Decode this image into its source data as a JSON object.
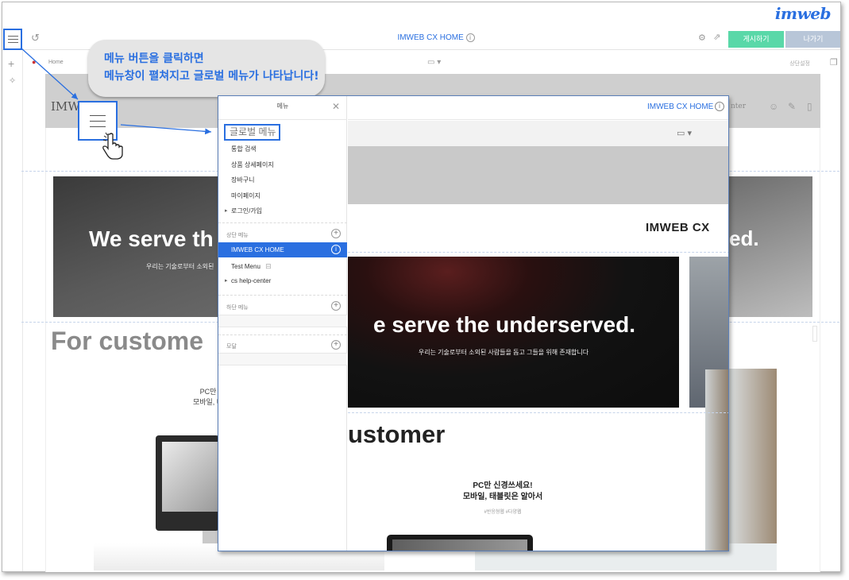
{
  "brand": {
    "logo_text": "imweb",
    "accent_color": "#2a6fe0"
  },
  "toolbar": {
    "menu_icon": "hamburger-icon",
    "undo_icon": "undo-icon",
    "document_title": "IMWEB CX HOME",
    "settings_icon": "gear-icon",
    "preview_icon": "external-link-icon",
    "publish_label": "게시하기",
    "exit_label": "나가기"
  },
  "sub_bar": {
    "home_label": "Home",
    "device_icon": "monitor-icon",
    "right_label": "상단설정"
  },
  "callout": {
    "line1": "메뉴 버튼을 클릭하면",
    "line2": "메뉴창이 펼쳐지고 글로벌 메뉴가 나타납니다!"
  },
  "background_page": {
    "logo": "IMWEB",
    "hero_title": "We serve th",
    "hero_title_right": "ed.",
    "hero_sub": "우리는 기술로부터 소외된",
    "section_title": "For custome",
    "pc_line1": "PC만",
    "pc_line2": "모바일, 태"
  },
  "menu_panel": {
    "title": "메뉴",
    "global_menu_title": "글로벌 메뉴",
    "global_items": [
      "통합 검색",
      "상품 상세페이지",
      "장바구니",
      "마이페이지",
      "로그인/가입"
    ],
    "top_menu_label": "상단 메뉴",
    "top_items": [
      "IMWEB CX HOME",
      "Test Menu",
      "cs help-center"
    ],
    "bottom_menu_label": "하단 메뉴",
    "modal_label": "모달"
  },
  "preview": {
    "page_title": "IMWEB CX HOME",
    "logo": "IMWEB CX",
    "hero_title": "e serve the underserved.",
    "hero_sub": "우리는 기술로부터 소외된 사람들을 돕고 그들을 위해 존재합니다",
    "customer_title": "ustomer",
    "pc_line1": "PC만 신경쓰세요!",
    "pc_line2": "모바일, 태블릿은 알아서",
    "tags": "#반응형웹 #다양웹",
    "right_text_fragment": "nter"
  }
}
